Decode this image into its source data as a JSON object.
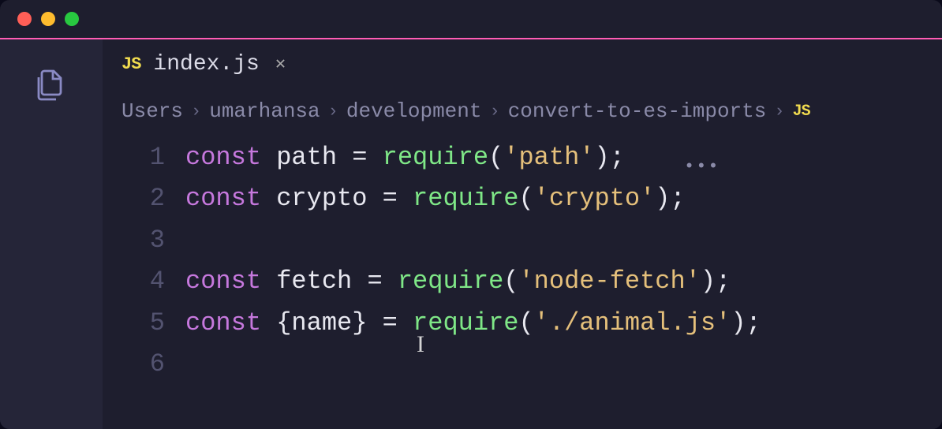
{
  "tab": {
    "filename": "index.js",
    "badge": "JS",
    "close": "✕"
  },
  "breadcrumb": {
    "segments": [
      "Users",
      "umarhansa",
      "development",
      "convert-to-es-imports"
    ],
    "trailing_badge": "JS"
  },
  "gutter": {
    "lines": [
      "1",
      "2",
      "3",
      "4",
      "5",
      "6"
    ]
  },
  "code": {
    "lines": [
      {
        "kw": "const",
        "name": "path",
        "eq": "=",
        "fn": "require",
        "open": "(",
        "str": "'path'",
        "close": ")",
        "semi": ";"
      },
      {
        "kw": "const",
        "name": "crypto",
        "eq": "=",
        "fn": "require",
        "open": "(",
        "str": "'crypto'",
        "close": ")",
        "semi": ";"
      },
      {
        "blank": ""
      },
      {
        "kw": "const",
        "name": "fetch",
        "eq": "=",
        "fn": "require",
        "open": "(",
        "str": "'node-fetch'",
        "close": ")",
        "semi": ";"
      },
      {
        "kw": "const",
        "lbrace": "{",
        "name": "name",
        "rbrace": "}",
        "eq": "=",
        "fn": "require",
        "open": "(",
        "str": "'./animal.js'",
        "close": ")",
        "semi": ";"
      },
      {
        "blank": ""
      }
    ],
    "hint": "•••"
  }
}
